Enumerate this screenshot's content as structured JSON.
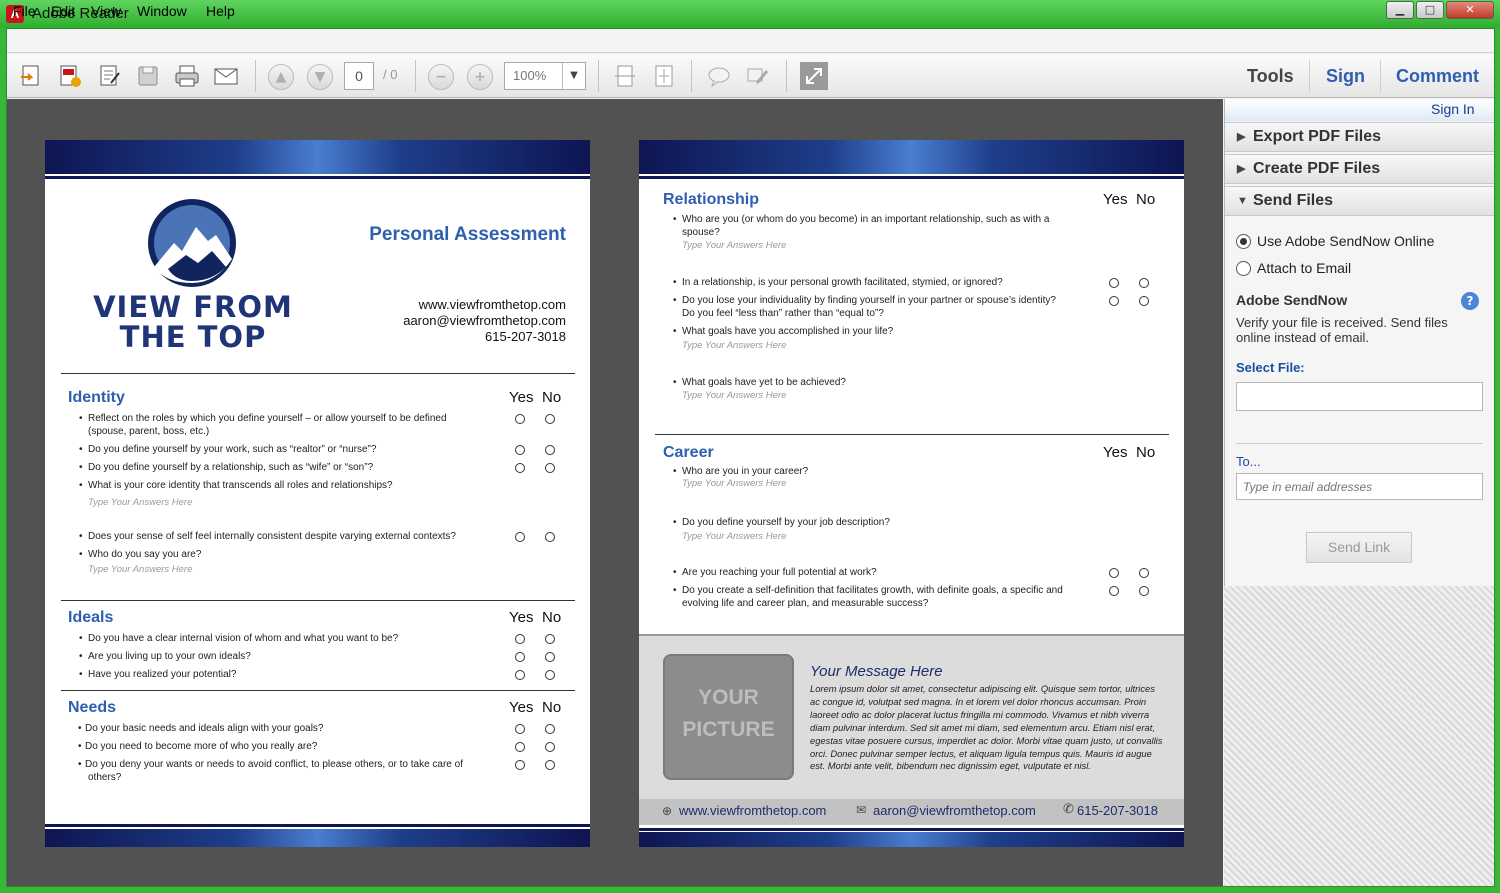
{
  "window": {
    "title": "Adobe Reader",
    "min": "▁",
    "max": "□",
    "close": "✕"
  },
  "menu": [
    "File",
    "Edit",
    "View",
    "Window",
    "Help"
  ],
  "toolbar": {
    "page_current": "0",
    "page_total": "/ 0",
    "zoom": "100%",
    "tabs": [
      "Tools",
      "Sign",
      "Comment"
    ]
  },
  "right_pane": {
    "sign_in": "Sign In",
    "sections": [
      "Export PDF Files",
      "Create PDF Files",
      "Send Files"
    ],
    "option_online": "Use Adobe SendNow Online",
    "option_attach": "Attach to Email",
    "sendnow_title": "Adobe SendNow",
    "sendnow_desc_1": "Verify your file is received. Send files",
    "sendnow_desc_2": "online instead of email.",
    "select_file": "Select File:",
    "to_label": "To...",
    "to_placeholder": "Type in email addresses",
    "send_button": "Send Link"
  },
  "left_page": {
    "logo_line1": "VIEW FROM",
    "logo_line2": "THE TOP",
    "heading": "Personal Assessment",
    "web": "www.viewfromthetop.com",
    "email": "aaron@viewfromthetop.com",
    "phone": "615-207-3018",
    "yes": "Yes",
    "no": "No",
    "answer_hint": "Type Your Answers Here",
    "identity": {
      "title": "Identity",
      "questions": [
        "Reflect on the roles by which you define yourself – or allow yourself to be defined",
        "(spouse, parent, boss, etc.)",
        "Do you define yourself by your work, such as “realtor” or “nurse”?",
        "Do you define yourself by a relationship, such as “wife” or “son”?",
        "What is your core identity that transcends all roles and relationships?",
        "Does your sense of self feel internally consistent despite varying external contexts?",
        "Who do you say you are?"
      ]
    },
    "ideals": {
      "title": "Ideals",
      "questions": [
        "Do you have a clear internal vision of whom and what you want to be?",
        "Are you living up to your own ideals?",
        "Have you realized your potential?"
      ]
    },
    "needs": {
      "title": "Needs",
      "questions": [
        "Do your basic needs and ideals align with your goals?",
        "Do you need to become more of who you really are?",
        "Do you deny your wants or needs to avoid conflict, to please others, or to take care of",
        "others?"
      ]
    }
  },
  "right_page": {
    "yes": "Yes",
    "no": "No",
    "answer_hint": "Type Your Answers Here",
    "relationship": {
      "title": "Relationship",
      "questions": [
        "Who are you (or whom do you become) in an important relationship, such as with a",
        "spouse?",
        "In a relationship, is your personal growth facilitated, stymied, or ignored?",
        "Do you lose your individuality by finding yourself in your partner or spouse’s identity?",
        "Do you feel “less than” rather than “equal to”?",
        "What goals have you accomplished in your life?",
        "What goals have yet to be achieved?"
      ]
    },
    "career": {
      "title": "Career",
      "questions": [
        "Who are you in your career?",
        "Do you define yourself by your job description?",
        "Are you reaching your full potential at work?",
        "Do you create a self-definition that facilitates growth, with definite goals, a specific and",
        "evolving life and career plan, and measurable success?"
      ]
    },
    "picture_1": "YOUR",
    "picture_2": "PICTURE",
    "message_title": "Your Message Here",
    "message_body": "Lorem ipsum dolor sit amet, consectetur adipiscing elit. Quisque sem tortor, ultrices ac congue id, volutpat sed magna. In et lorem vel dolor rhoncus accumsan. Proin laoreet odio ac dolor placerat luctus fringilla mi commodo. Vivamus et nibh viverra diam pulvinar interdum. Sed sit amet mi diam, sed elementum arcu. Etiam nisl erat, egestas vitae posuere cursus, imperdiet ac dolor. Morbi vitae quam justo, ut convallis orci. Donec pulvinar semper lectus, et aliquam ligula tempus quis. Mauris id augue est. Morbi ante velit, bibendum nec dignissim eget, vulputate et nisl.",
    "footer_web": "www.viewfromthetop.com",
    "footer_email": "aaron@viewfromthetop.com",
    "footer_phone": "615-207-3018"
  }
}
